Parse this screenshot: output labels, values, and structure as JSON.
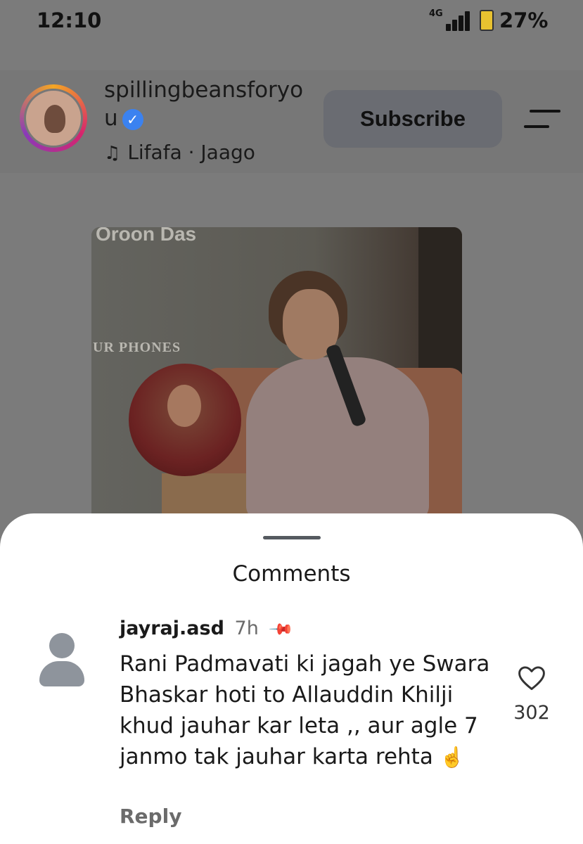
{
  "status_bar": {
    "time": "12:10",
    "network": "4G",
    "battery": "27%"
  },
  "post": {
    "username": "spillingbeansforyou",
    "music": "Lifafa · Jaago",
    "subscribe_label": "Subscribe"
  },
  "video": {
    "overlay_top": "Oroon Das",
    "overlay_mid": "UR PHONES"
  },
  "comments": {
    "title": "Comments",
    "items": [
      {
        "user": "jayraj.asd",
        "time": "7h",
        "text": "Rani Padmavati ki jagah ye Swara Bhaskar hoti to Allauddin Khilji khud jauhar kar leta ,, aur agle 7 janmo tak jauhar karta rehta",
        "emoji": "☝️",
        "likes": "302",
        "reply_label": "Reply"
      }
    ]
  },
  "icons": {
    "verified": "verified-badge-icon",
    "music": "music-note-icon",
    "menu": "menu-icon",
    "pin": "pin-icon",
    "like": "heart-icon"
  }
}
